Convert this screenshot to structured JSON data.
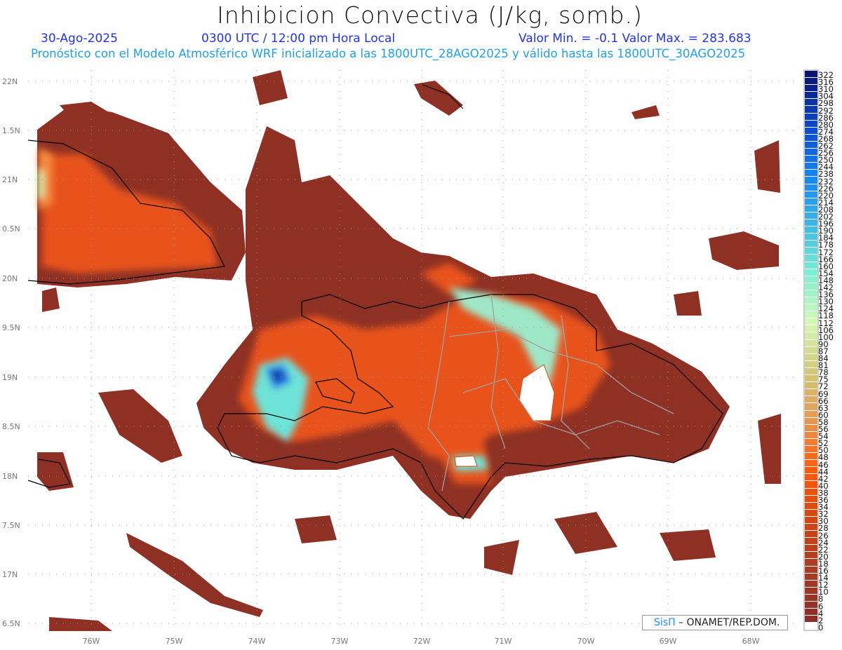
{
  "header": {
    "title": "Inhibicion Convectiva (J/kg, somb.)",
    "date": "30-Ago-2025",
    "time": "0300 UTC / 12:00 pm Hora Local",
    "value_range": "Valor Min. = -0.1  Valor Max. = 283.683",
    "forecast_note": "Pronóstico con el Modelo Atmosférico WRF inicializado a las 1800UTC_28AGO2025 y válido hasta las  1800UTC_30AGO2025"
  },
  "map": {
    "lat_labels": [
      "22N",
      "1.5N",
      "21N",
      "0.5N",
      "20N",
      "9.5N",
      "19N",
      "8.5N",
      "18N",
      "7.5N",
      "17N",
      "6.5N"
    ],
    "lon_labels": [
      "76W",
      "75W",
      "74W",
      "73W",
      "72W",
      "71W",
      "70W",
      "69W",
      "68W"
    ],
    "colors": {
      "low": "#8e3124",
      "mid": "#f05a14",
      "high_orange": "#f48a40",
      "pale": "#cff5b0",
      "cyan": "#6ee3d8",
      "blue": "#1c6fe0",
      "dark_blue": "#0a1a80",
      "coast": "#000000",
      "borders": "#a0a0a0"
    }
  },
  "colorbar": {
    "labels": [
      "322",
      "316",
      "310",
      "304",
      "298",
      "292",
      "286",
      "280",
      "274",
      "268",
      "262",
      "256",
      "250",
      "244",
      "238",
      "232",
      "226",
      "220",
      "214",
      "208",
      "202",
      "196",
      "190",
      "184",
      "178",
      "172",
      "166",
      "160",
      "154",
      "148",
      "142",
      "136",
      "130",
      "124",
      "118",
      "112",
      "106",
      "100",
      "90",
      "87",
      "84",
      "81",
      "78",
      "75",
      "72",
      "69",
      "66",
      "63",
      "60",
      "58",
      "56",
      "54",
      "52",
      "50",
      "48",
      "46",
      "44",
      "42",
      "40",
      "38",
      "36",
      "34",
      "32",
      "30",
      "28",
      "26",
      "24",
      "22",
      "20",
      "18",
      "16",
      "14",
      "12",
      "10",
      "8",
      "6",
      "4",
      "2",
      "0"
    ],
    "anchor_colors": [
      "#0a1470",
      "#0a46c8",
      "#1482f0",
      "#3cb4e6",
      "#78f0d2",
      "#d2fab4",
      "#d2c878",
      "#e69650",
      "#ff5a0a",
      "#d2460f",
      "#aa3c23",
      "#8c2d28",
      "#ffffff"
    ]
  },
  "credit": {
    "brand": "SisΠ",
    "text": " – ONAMET/REP.DOM."
  }
}
